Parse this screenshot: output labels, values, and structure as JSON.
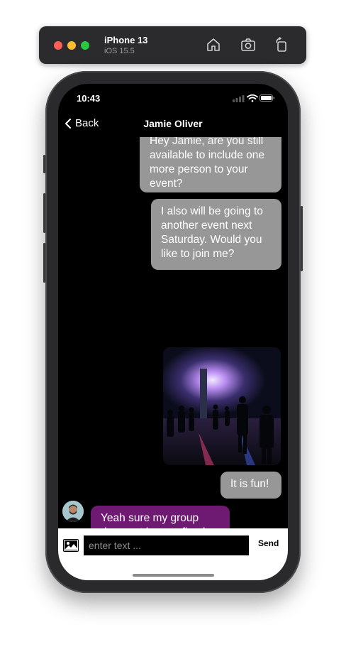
{
  "simulator": {
    "device_name": "iPhone 13",
    "os_version": "iOS 15.5",
    "buttons": [
      "home-icon",
      "screenshot-icon",
      "rotate-icon"
    ]
  },
  "status_bar": {
    "time": "10:43"
  },
  "nav": {
    "back_label": "Back",
    "title": "Jamie Oliver"
  },
  "messages": [
    {
      "direction": "out",
      "type": "text",
      "text": "Hey Jamie, are you still available to include one more person to your event?"
    },
    {
      "direction": "out",
      "type": "text",
      "text": "I also will be going to another event next Saturday. Would you like to join me?"
    },
    {
      "direction": "out",
      "type": "image",
      "icon": "concert-photo"
    },
    {
      "direction": "out",
      "type": "text",
      "text": "It is fun!"
    },
    {
      "direction": "in",
      "type": "text",
      "text": "Yeah sure my group does not have a fixed number of people. You can apply whenever you like."
    }
  ],
  "composer": {
    "placeholder": "enter text ...",
    "value": "",
    "send_label": "Send"
  },
  "colors": {
    "outgoing_bubble": "#979797",
    "incoming_bubble": "#6e1a72",
    "background": "#000000"
  }
}
